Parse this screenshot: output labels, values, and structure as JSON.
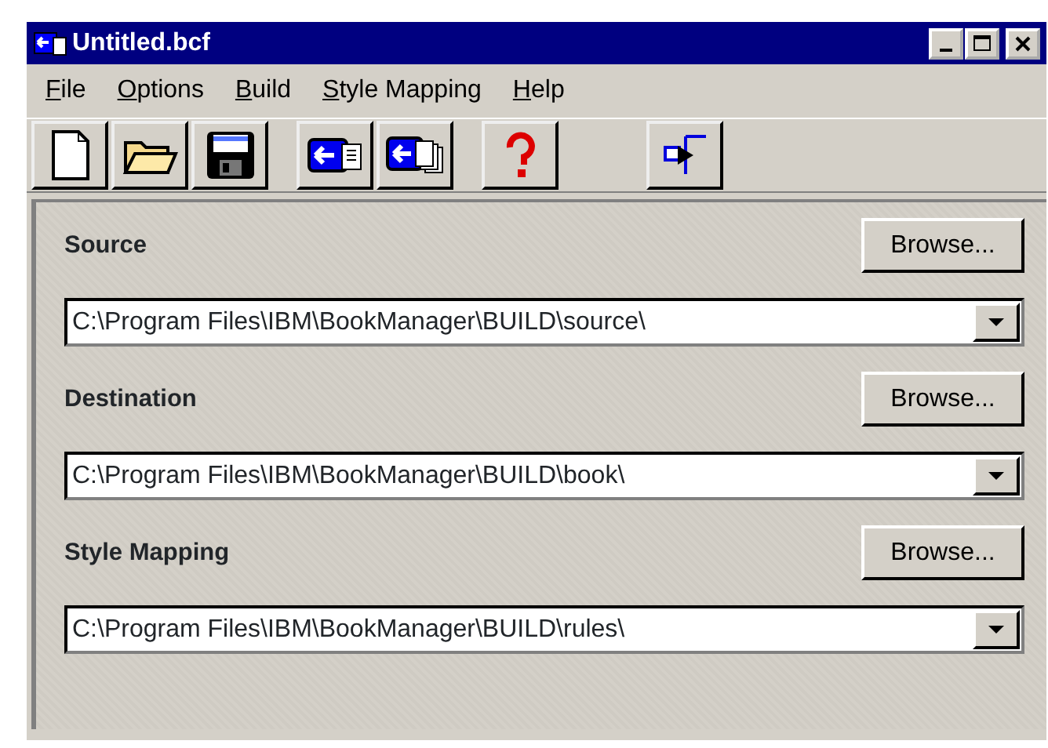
{
  "window": {
    "title": "Untitled.bcf"
  },
  "menu": [
    "File",
    "Options",
    "Build",
    "Style Mapping",
    "Help"
  ],
  "sections": [
    {
      "label": "Source",
      "button": "Browse...",
      "path": "C:\\Program Files\\IBM\\BookManager\\BUILD\\source\\"
    },
    {
      "label": "Destination",
      "button": "Browse...",
      "path": "C:\\Program Files\\IBM\\BookManager\\BUILD\\book\\"
    },
    {
      "label": "Style Mapping",
      "button": "Browse...",
      "path": "C:\\Program Files\\IBM\\BookManager\\BUILD\\rules\\"
    }
  ]
}
